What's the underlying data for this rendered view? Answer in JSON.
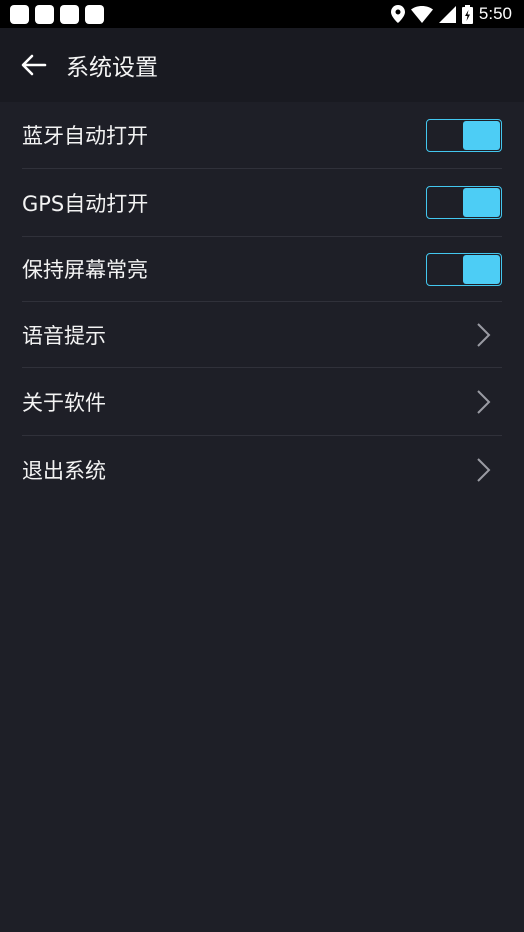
{
  "statusbar": {
    "time": "5:50",
    "notification_icons": [
      "notification-icon",
      "notification-icon",
      "notification-icon",
      "notification-icon"
    ],
    "system_icons": [
      "location-icon",
      "wifi-icon",
      "signal-icon",
      "battery-icon"
    ]
  },
  "header": {
    "title": "系统设置",
    "back_icon": "arrow-left-icon"
  },
  "settings": [
    {
      "label": "蓝牙自动打开",
      "type": "toggle",
      "on": true
    },
    {
      "label": "GPS自动打开",
      "type": "toggle",
      "on": true
    },
    {
      "label": "保持屏幕常亮",
      "type": "toggle",
      "on": true
    },
    {
      "label": "语音提示",
      "type": "link"
    },
    {
      "label": "关于软件",
      "type": "link"
    },
    {
      "label": "退出系统",
      "type": "link"
    }
  ],
  "colors": {
    "background": "#1e1f27",
    "appbar": "#191a21",
    "accent": "#4dcdf5",
    "divider": "#30313a"
  }
}
